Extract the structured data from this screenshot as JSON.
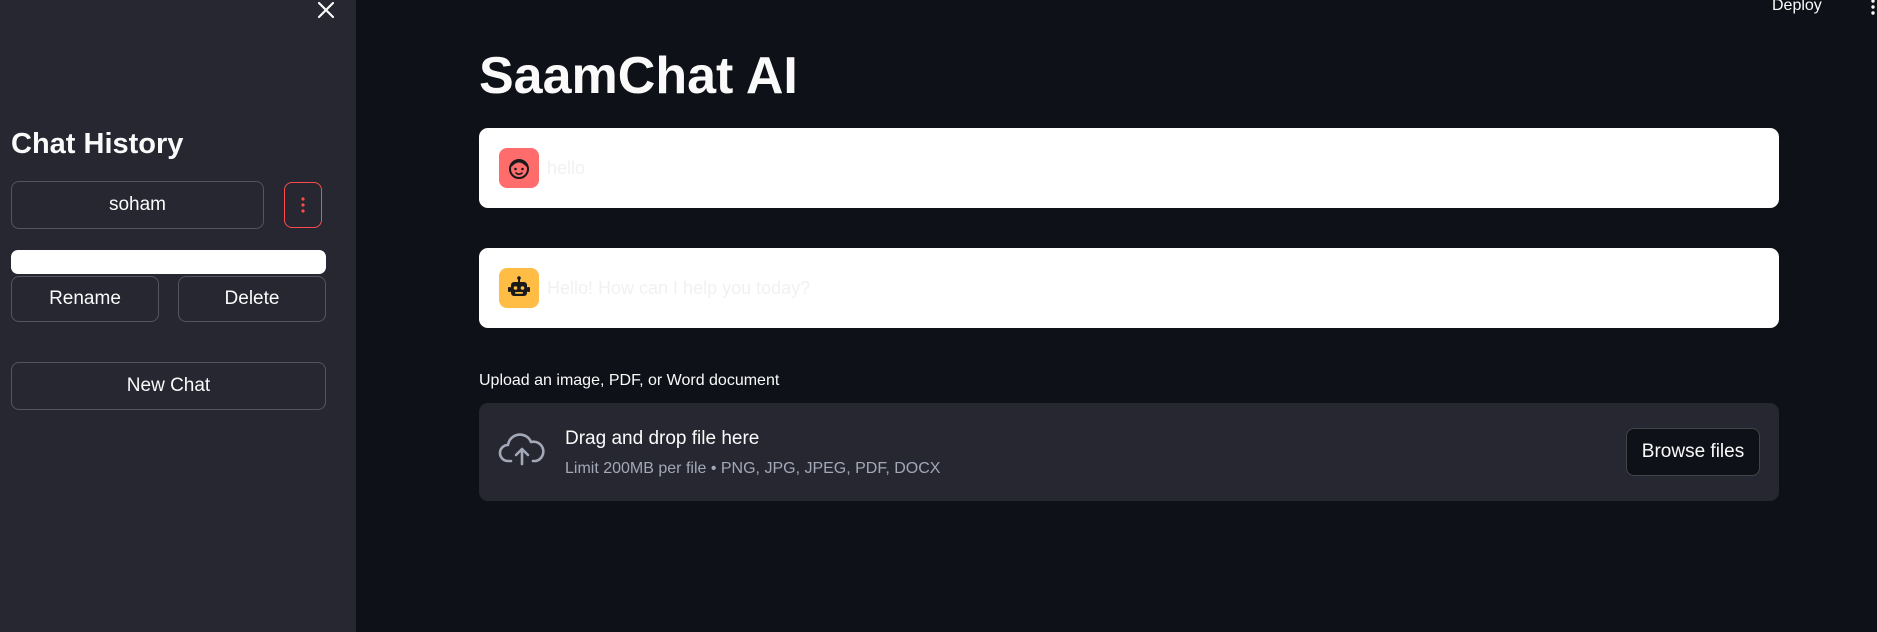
{
  "sidebar": {
    "title": "Chat History",
    "close_icon": "close-icon",
    "chats": [
      {
        "label": "soham"
      }
    ],
    "chat_menu_icon": "more-vertical-icon",
    "rename_input": {
      "value": "",
      "placeholder": ""
    },
    "rename_label": "Rename",
    "delete_label": "Delete",
    "new_chat_label": "New Chat"
  },
  "header": {
    "deploy_label": "Deploy",
    "menu_icon": "more-vertical-icon"
  },
  "main": {
    "title": "SaamChat AI",
    "messages": [
      {
        "role": "user",
        "avatar_icon": "user-face-icon",
        "text": "hello"
      },
      {
        "role": "assistant",
        "avatar_icon": "robot-icon",
        "text": "Hello! How can I help you today?"
      }
    ],
    "uploader": {
      "label": "Upload an image, PDF, or Word document",
      "icon": "cloud-upload-icon",
      "drop_text": "Drag and drop file here",
      "limit_text": "Limit 200MB per file • PNG, JPG, JPEG, PDF, DOCX",
      "browse_label": "Browse files"
    }
  },
  "colors": {
    "background": "#0e1117",
    "sidebar": "#262730",
    "accent": "#ff4b4b",
    "user_avatar": "#ff6c6c",
    "bot_avatar": "#ffbd45"
  }
}
